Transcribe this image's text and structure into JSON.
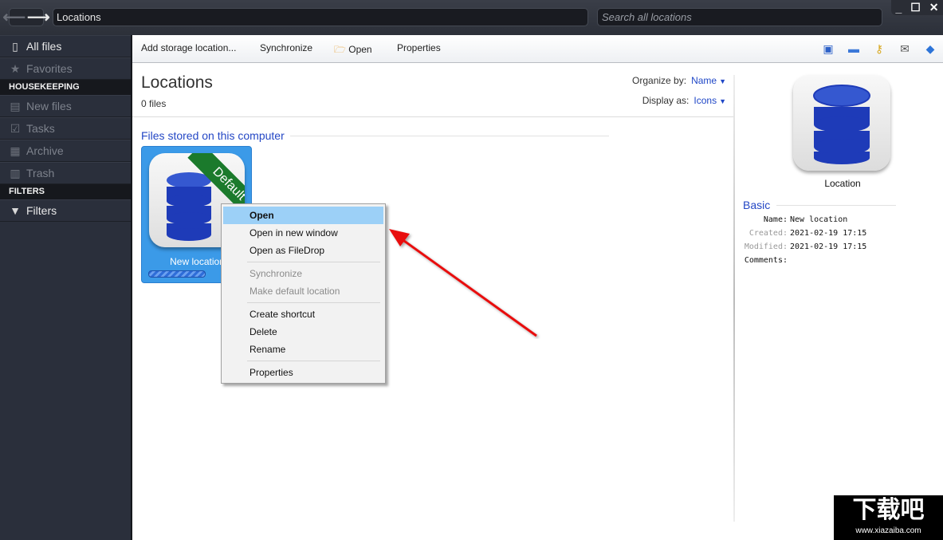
{
  "titlebar": {
    "address": "Locations",
    "search_placeholder": "Search all locations",
    "minimize": "_",
    "maximize": "☐",
    "close": "✕"
  },
  "sidebar": {
    "items_top": [
      {
        "label": "All files",
        "icon": "file-icon",
        "glyph": "📄",
        "dim": false
      },
      {
        "label": "Favorites",
        "icon": "star-icon",
        "glyph": "★",
        "dim": true
      }
    ],
    "housekeeping_title": "HOUSEKEEPING",
    "housekeeping": [
      {
        "label": "New files",
        "icon": "new-file-icon",
        "glyph": "▤"
      },
      {
        "label": "Tasks",
        "icon": "clipboard-icon",
        "glyph": "☑"
      },
      {
        "label": "Archive",
        "icon": "archive-icon",
        "glyph": "▦"
      },
      {
        "label": "Trash",
        "icon": "trash-icon",
        "glyph": "🗑"
      }
    ],
    "filters_title": "FILTERS",
    "filters": [
      {
        "label": "Filters",
        "icon": "funnel-icon",
        "glyph": "▼"
      }
    ]
  },
  "toolbar": {
    "add_storage": "Add storage location...",
    "synchronize": "Synchronize",
    "open": "Open",
    "properties": "Properties",
    "right_icons": [
      "panel-icon",
      "card-icon",
      "key-icon",
      "mail-icon",
      "info-icon"
    ]
  },
  "content": {
    "title": "Locations",
    "file_count": "0 files",
    "organize_label": "Organize by:",
    "organize_value": "Name",
    "display_label": "Display as:",
    "display_value": "Icons",
    "group_title": "Files stored on this computer",
    "tile": {
      "label": "New location",
      "ribbon": "Default"
    }
  },
  "details": {
    "title": "Location",
    "section": "Basic",
    "props": [
      {
        "key": "Name:",
        "value": "New location",
        "dim": false
      },
      {
        "key": "Created:",
        "value": "2021-02-19 17:15",
        "dim": true
      },
      {
        "key": "Modified:",
        "value": "2021-02-19 17:15",
        "dim": true
      },
      {
        "key": "Comments:",
        "value": "",
        "dim": false
      }
    ]
  },
  "context_menu": {
    "items": [
      {
        "label": "Open",
        "highlighted": true,
        "disabled": false
      },
      {
        "label": "Open in new window",
        "disabled": false
      },
      {
        "label": "Open as FileDrop",
        "disabled": false
      },
      {
        "separator": true
      },
      {
        "label": "Synchronize",
        "disabled": true
      },
      {
        "label": "Make default location",
        "disabled": true
      },
      {
        "separator": true
      },
      {
        "label": "Create shortcut",
        "disabled": false
      },
      {
        "label": "Delete",
        "disabled": false
      },
      {
        "label": "Rename",
        "disabled": false
      },
      {
        "separator": true
      },
      {
        "label": "Properties",
        "disabled": false
      }
    ]
  },
  "watermark": {
    "text": "下载吧",
    "url": "www.xiazaiba.com"
  },
  "colors": {
    "accent_blue": "#2447c5",
    "tile_blue": "#3b9ae8",
    "menu_highlight": "#9cd0f7",
    "ribbon_green": "#1b7a2c",
    "arrow_red": "#e81010"
  }
}
